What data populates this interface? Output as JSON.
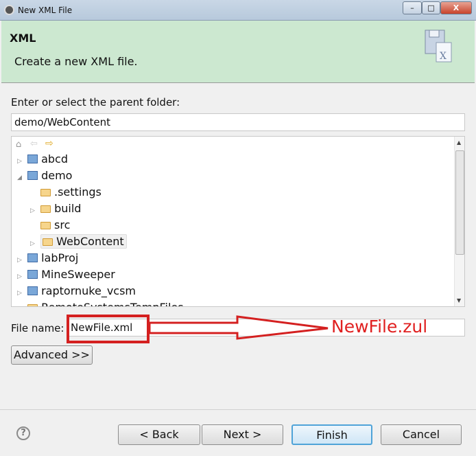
{
  "window": {
    "title": "New XML File",
    "minimize": "–",
    "maximize": "□",
    "close": "X"
  },
  "header": {
    "title": "XML",
    "description": "Create a new XML file."
  },
  "parent_folder": {
    "label": "Enter or select the parent folder:",
    "value": "demo/WebContent"
  },
  "tree": {
    "items": [
      {
        "label": "abcd",
        "type": "project",
        "expanded": false
      },
      {
        "label": "demo",
        "type": "project",
        "expanded": true
      },
      {
        "label": ".settings",
        "type": "folder"
      },
      {
        "label": "build",
        "type": "folder",
        "expanded": false
      },
      {
        "label": "src",
        "type": "folder"
      },
      {
        "label": "WebContent",
        "type": "folder",
        "expanded": false,
        "selected": true
      },
      {
        "label": "labProj",
        "type": "project",
        "expanded": false
      },
      {
        "label": "MineSweeper",
        "type": "project",
        "expanded": false
      },
      {
        "label": "raptornuke_vcsm",
        "type": "project",
        "expanded": false
      },
      {
        "label": "RemoteSystemsTempFiles",
        "type": "project"
      }
    ]
  },
  "file_name": {
    "label": "File name:",
    "value": "NewFile.xml"
  },
  "annotation": {
    "text": "NewFile.zul",
    "color": "#e02020"
  },
  "buttons": {
    "advanced": "Advanced >>",
    "back": "< Back",
    "next": "Next >",
    "finish": "Finish",
    "cancel": "Cancel",
    "help": "?"
  }
}
